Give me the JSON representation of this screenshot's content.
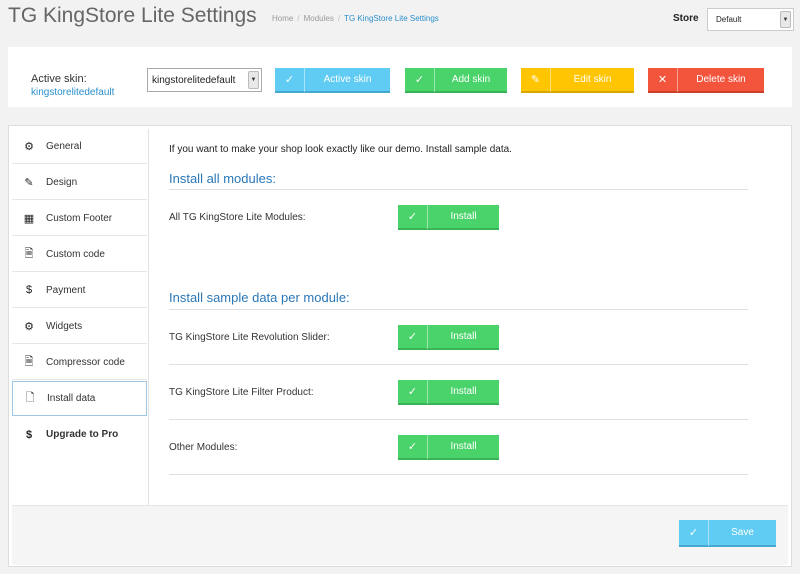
{
  "header": {
    "title": "TG KingStore Lite Settings",
    "breadcrumb": [
      "Home",
      "Modules",
      "TG KingStore Lite Settings"
    ],
    "store_label": "Store",
    "store_value": "Default"
  },
  "skin": {
    "active_label": "Active skin:",
    "active_value": "kingstorelitedefault",
    "select_value": "kingstorelitedefault",
    "buttons": {
      "active": "Active skin",
      "add": "Add skin",
      "edit": "Edit skin",
      "delete": "Delete skin"
    }
  },
  "sidebar": {
    "items": [
      {
        "label": "General",
        "icon": "gear-icon"
      },
      {
        "label": "Design",
        "icon": "pencil-icon"
      },
      {
        "label": "Custom Footer",
        "icon": "table-icon"
      },
      {
        "label": "Custom code",
        "icon": "code-file-icon"
      },
      {
        "label": "Payment",
        "icon": "dollar-icon"
      },
      {
        "label": "Widgets",
        "icon": "cogs-icon"
      },
      {
        "label": "Compressor code",
        "icon": "compress-file-icon"
      },
      {
        "label": "Install data",
        "icon": "document-icon"
      },
      {
        "label": "Upgrade to Pro",
        "icon": "dollar-icon"
      }
    ]
  },
  "content": {
    "intro": "If you want to make your shop look exactly like our demo. Install sample data.",
    "section1_title": "Install all modules:",
    "section2_title": "Install sample data per module:",
    "rows": {
      "all_modules": "All TG KingStore Lite Modules:",
      "revolution_slider": "TG KingStore Lite Revolution Slider:",
      "filter_product": "TG KingStore Lite Filter Product:",
      "other_modules": "Other Modules:"
    },
    "install_label": "Install"
  },
  "footer": {
    "save_label": "Save"
  },
  "colors": {
    "blue": "#60ccf3",
    "green": "#4bd36b",
    "yellow": "#ffc500",
    "red": "#f2543c",
    "link": "#2a8fcc"
  }
}
